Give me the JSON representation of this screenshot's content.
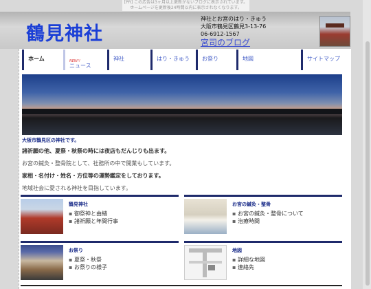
{
  "notice": "[PR] この広告は3ヶ月以上更新がないブログに表示されています。ホームページを更新後24時間以内に表示されなくなります。",
  "header": {
    "logo": "鶴見神社",
    "address_line1": "神社とお宮のはり・きゅう",
    "address_line2": "大阪市鶴見区鶴見3-13-76",
    "phone": "06-6912-1567",
    "blog_link": "宮司のブログ"
  },
  "nav": [
    {
      "label": "ホーム"
    },
    {
      "label": "ニュース",
      "badge": "NEW!!"
    },
    {
      "label": "神社"
    },
    {
      "label": "はり・きゅう"
    },
    {
      "label": "お祭り"
    },
    {
      "label": "地図"
    },
    {
      "label": "サイトマップ"
    }
  ],
  "intro": {
    "title": "大阪市鶴見区の神社です。",
    "line1": "諸祈願の他、夏祭・秋祭の時には夜店もだんじりも出ます。",
    "line2": "お宮の鍼灸・整骨院として、社務所の中で開業もしています。",
    "line3": "家相・名付け・姓名・方位等の運勢鑑定をしております。",
    "line4": "地域社会に愛される神社を目指しています。"
  },
  "cards": [
    {
      "title": "鶴見神社",
      "links": [
        "御祭神と由緒",
        "諸祈願と年間行事"
      ]
    },
    {
      "title": "お宮の鍼灸・整骨",
      "links": [
        "お宮の鍼灸・整骨について",
        "治療時間"
      ]
    },
    {
      "title": "お祭り",
      "links": [
        "夏祭・秋祭",
        "お祭りの様子"
      ]
    },
    {
      "title": "地図",
      "links": [
        "詳細な地図",
        "連絡先"
      ]
    }
  ]
}
